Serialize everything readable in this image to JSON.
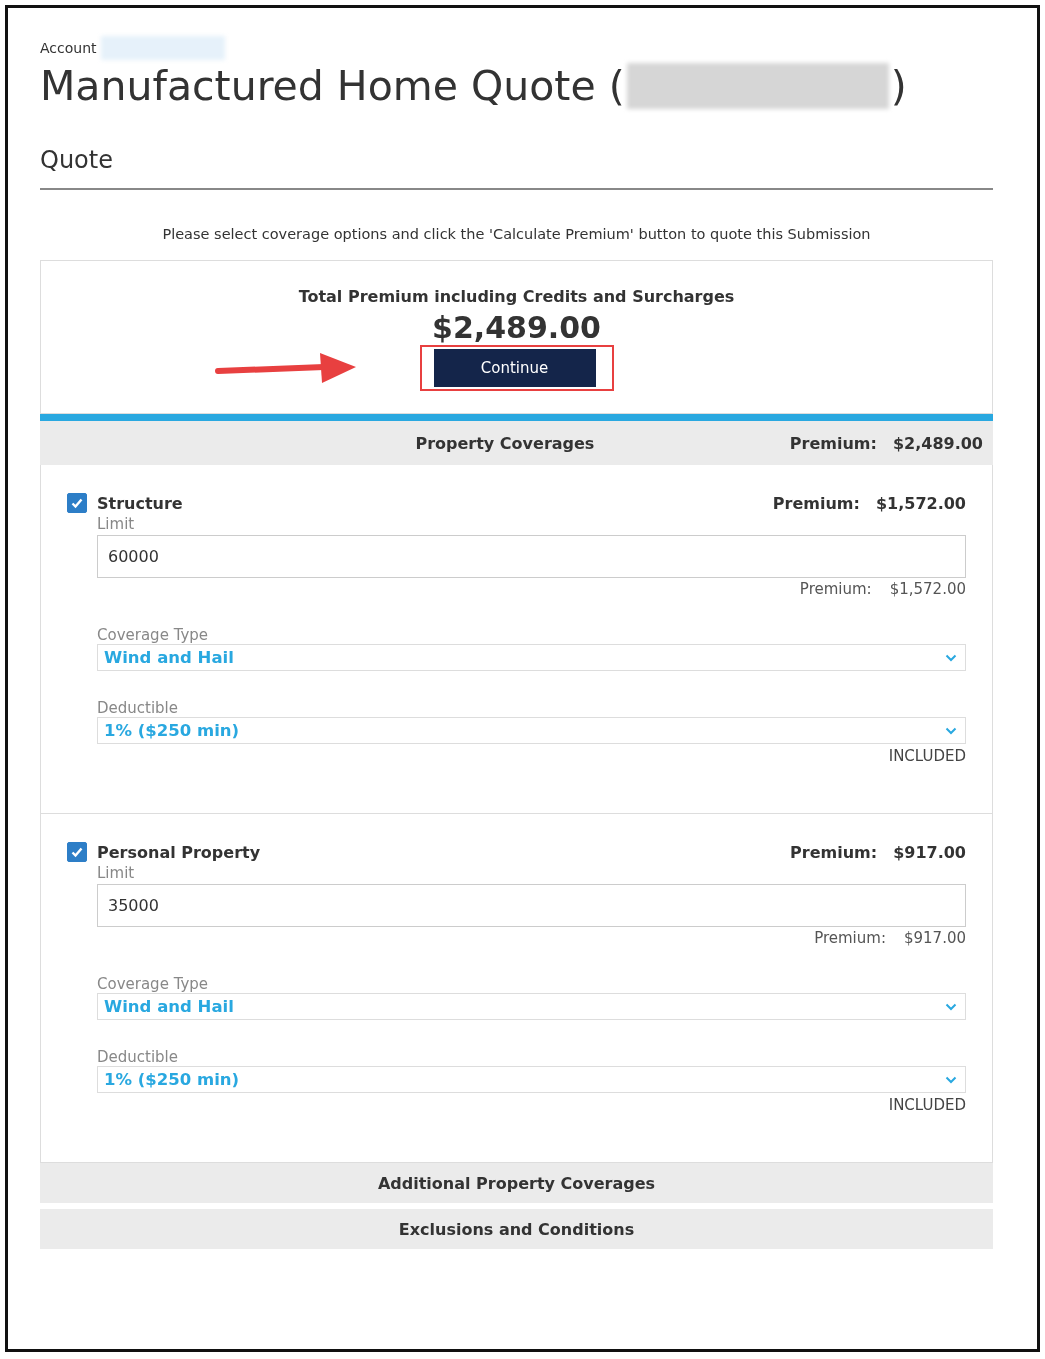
{
  "header": {
    "account_label": "Account",
    "title": "Manufactured Home Quote (",
    "title_end": ")",
    "section": "Quote"
  },
  "instructions": "Please select coverage options and click the 'Calculate Premium' button to quote this Submission",
  "summary": {
    "label": "Total Premium including Credits and Surcharges",
    "total": "$2,489.00",
    "button": "Continue"
  },
  "property_coverages": {
    "title": "Property Coverages",
    "premium_label": "Premium:",
    "premium": "$2,489.00",
    "coverages": [
      {
        "name": "Structure",
        "checked": true,
        "premium_label": "Premium:",
        "premium": "$1,572.00",
        "limit_label": "Limit",
        "limit": "60000",
        "limit_premium_label": "Premium:",
        "limit_premium": "$1,572.00",
        "type_label": "Coverage Type",
        "type": "Wind and Hail",
        "deductible_label": "Deductible",
        "deductible": "1% ($250 min)",
        "deductible_note": "INCLUDED"
      },
      {
        "name": "Personal Property",
        "checked": true,
        "premium_label": "Premium:",
        "premium": "$917.00",
        "limit_label": "Limit",
        "limit": "35000",
        "limit_premium_label": "Premium:",
        "limit_premium": "$917.00",
        "type_label": "Coverage Type",
        "type": "Wind and Hail",
        "deductible_label": "Deductible",
        "deductible": "1% ($250 min)",
        "deductible_note": "INCLUDED"
      }
    ]
  },
  "sections": [
    "Additional Property Coverages",
    "Exclusions and Conditions"
  ]
}
